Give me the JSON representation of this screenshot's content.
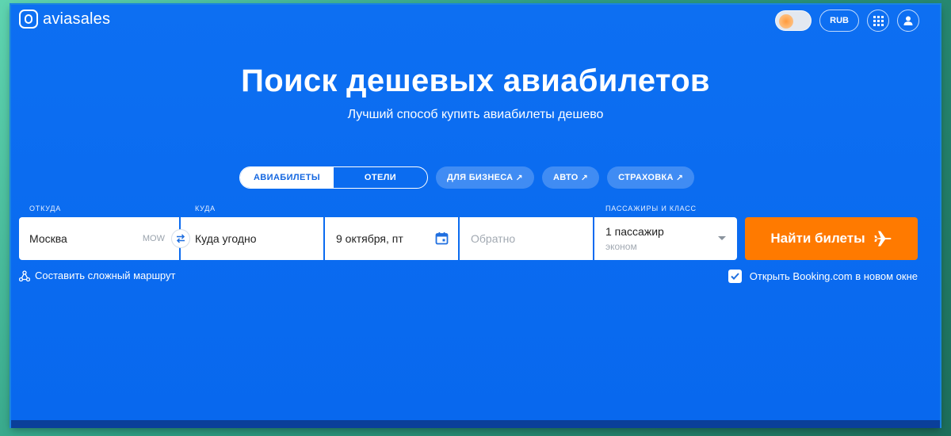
{
  "header": {
    "logo_text": "aviasales",
    "currency_label": "RUB"
  },
  "hero": {
    "title": "Поиск дешевых авиабилетов",
    "subtitle": "Лучший способ купить авиабилеты дешево"
  },
  "tabs": {
    "flights": "АВИАБИЛЕТЫ",
    "hotels": "ОТЕЛИ",
    "business": "ДЛЯ БИЗНЕСА",
    "auto": "АВТО",
    "insurance": "СТРАХОВКА",
    "external_arrow": "↗"
  },
  "form": {
    "from_label": "ОТКУДА",
    "to_label": "КУДА",
    "passengers_label": "ПАССАЖИРЫ И КЛАСС",
    "from_value": "Москва",
    "from_code": "MOW",
    "to_value": "Куда угодно",
    "date_value": "9 октября, пт",
    "return_placeholder": "Обратно",
    "passengers_value": "1 пассажир",
    "class_value": "эконом",
    "search_button": "Найти билеты"
  },
  "options": {
    "complex_route": "Составить сложный маршрут",
    "open_booking": "Открыть Booking.com в новом окне",
    "open_booking_checked": true
  },
  "colors": {
    "background": "#0b6ff0",
    "accent": "#ff7a00",
    "text_light": "#ffffff"
  }
}
